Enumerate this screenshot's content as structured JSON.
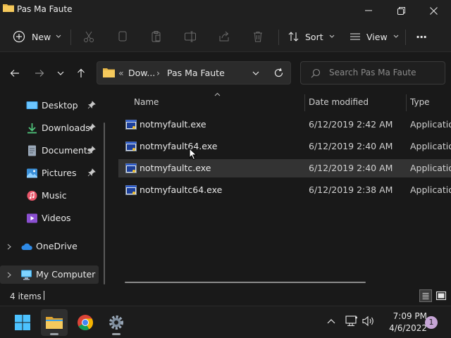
{
  "window": {
    "title": "Pas Ma Faute",
    "minimize_icon": "minimize-icon",
    "maximize_icon": "restore-icon",
    "close_icon": "close-icon"
  },
  "toolbar": {
    "new_label": "New",
    "sort_label": "Sort",
    "view_label": "View",
    "more_label": "···"
  },
  "address": {
    "overflow": "«",
    "crumbs": [
      "Dow...",
      "Pas Ma Faute"
    ],
    "separator": "›",
    "search_placeholder": "Search Pas Ma Faute"
  },
  "sidebar": {
    "items": [
      {
        "label": "Desktop",
        "icon": "desktop-icon",
        "pinned": true
      },
      {
        "label": "Downloads",
        "icon": "download-icon",
        "pinned": true
      },
      {
        "label": "Documents",
        "icon": "documents-icon",
        "pinned": true
      },
      {
        "label": "Pictures",
        "icon": "pictures-icon",
        "pinned": true
      },
      {
        "label": "Music",
        "icon": "music-icon",
        "pinned": false
      },
      {
        "label": "Videos",
        "icon": "videos-icon",
        "pinned": false
      },
      {
        "label": "OneDrive",
        "icon": "cloud-icon",
        "pinned": false
      },
      {
        "label": "My Computer",
        "icon": "computer-icon",
        "pinned": false
      }
    ]
  },
  "columns": {
    "name": "Name",
    "date": "Date modified",
    "type": "Type"
  },
  "files": [
    {
      "name": "notmyfault.exe",
      "date": "6/12/2019 2:42 AM",
      "type": "Application"
    },
    {
      "name": "notmyfault64.exe",
      "date": "6/12/2019 2:40 AM",
      "type": "Application"
    },
    {
      "name": "notmyfaultc.exe",
      "date": "6/12/2019 2:40 AM",
      "type": "Application"
    },
    {
      "name": "notmyfaultc64.exe",
      "date": "6/12/2019 2:38 AM",
      "type": "Application"
    }
  ],
  "status": {
    "item_count": "4 items"
  },
  "taskbar": {
    "time": "7:09 PM",
    "date": "4/6/2022",
    "notification_count": "1"
  },
  "colors": {
    "folder_yellow": "#e8b84a",
    "accent_blue": "#4cc2ff",
    "window_bg": "#191919",
    "hover_row": "#333333"
  }
}
